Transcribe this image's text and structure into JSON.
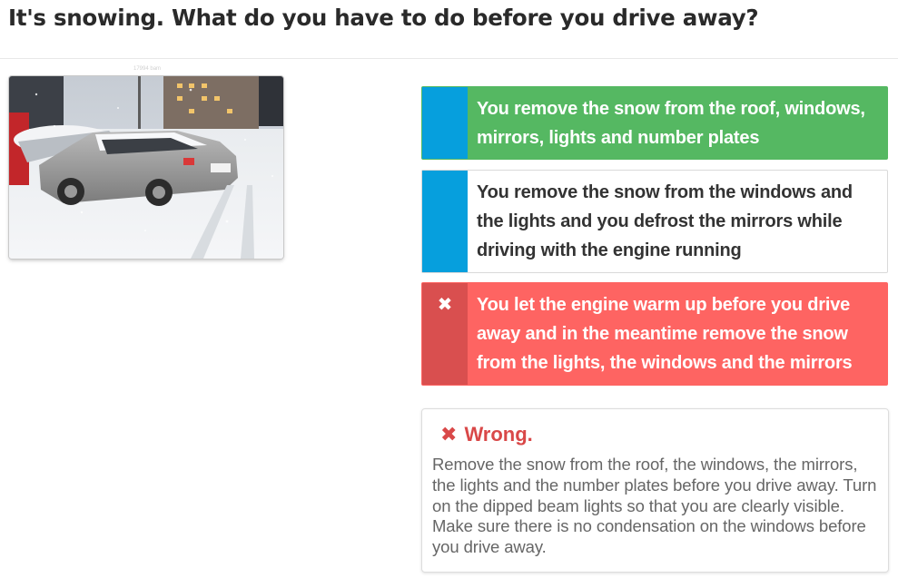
{
  "question": {
    "title": "It's snowing. What do you have to do before you drive away?",
    "image_caption": "17994 bam"
  },
  "answers": [
    {
      "label": "You remove the snow from the roof, windows, mirrors, lights and number plates",
      "state": "correct",
      "accent": "#55b862"
    },
    {
      "label": "You remove the snow from the windows and the lights and you defrost the mirrors while driving with the engine running",
      "state": "unselected",
      "accent": "#069fdd"
    },
    {
      "label": "You let the engine warm up before you drive away and in the meantime remove the snow from the lights, the windows and the mirrors",
      "state": "selected-wrong",
      "accent": "#fe6462",
      "icon": "x-icon"
    }
  ],
  "feedback": {
    "icon": "x-icon",
    "title": "Wrong.",
    "body": "Remove the snow from the roof, the windows, the mirrors, the lights and the number plates before you drive away. Turn on the dipped beam lights so that you are clearly visible. Make sure there is no condensation on the windows before you drive away.",
    "color": "#d94848"
  }
}
